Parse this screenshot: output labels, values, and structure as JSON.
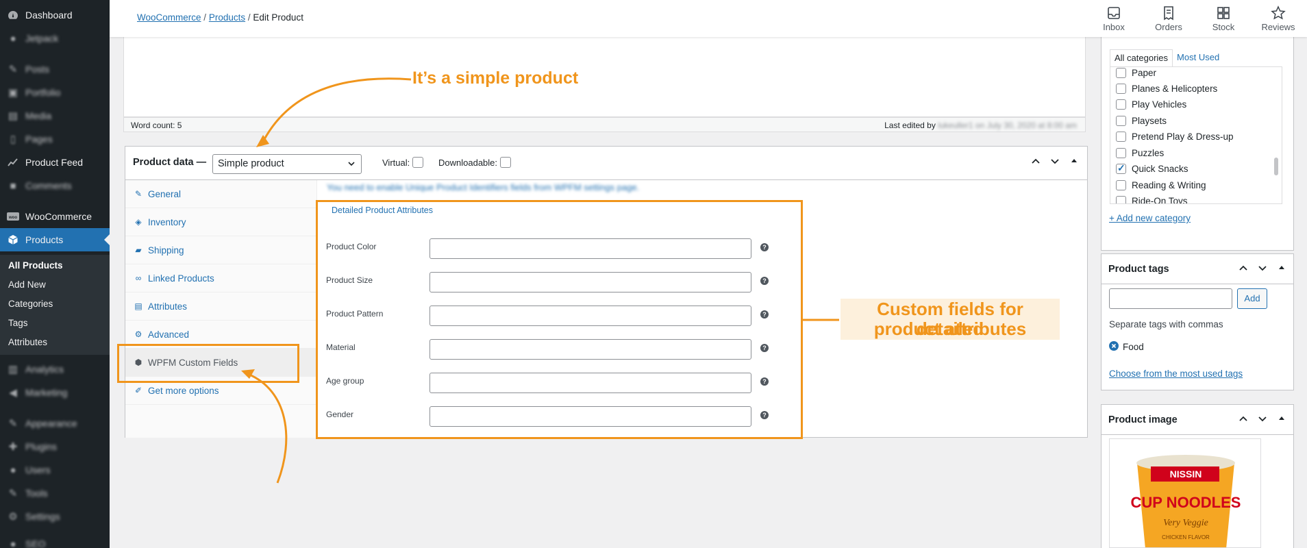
{
  "sidebar": {
    "items": [
      {
        "label": "Dashboard",
        "icon": "dashboard-icon"
      },
      {
        "label": "Jetpack",
        "icon": "jetpack-icon"
      },
      {
        "label": "Posts",
        "icon": "pin-icon"
      },
      {
        "label": "Portfolio",
        "icon": "portfolio-icon"
      },
      {
        "label": "Media",
        "icon": "media-icon"
      },
      {
        "label": "Pages",
        "icon": "pages-icon"
      },
      {
        "label": "Product Feed",
        "icon": "chart-line-icon"
      },
      {
        "label": "Comments",
        "icon": "comment-icon"
      },
      {
        "label": "WooCommerce",
        "icon": "woo-icon"
      },
      {
        "label": "Products",
        "icon": "box-icon"
      },
      {
        "label": "Analytics",
        "icon": "analytics-icon"
      },
      {
        "label": "Marketing",
        "icon": "megaphone-icon"
      },
      {
        "label": "Appearance",
        "icon": "brush-icon"
      },
      {
        "label": "Plugins",
        "icon": "plug-icon"
      },
      {
        "label": "Users",
        "icon": "user-icon"
      },
      {
        "label": "Tools",
        "icon": "wrench-icon"
      },
      {
        "label": "Settings",
        "icon": "settings-icon"
      },
      {
        "label": "SEO",
        "icon": "seo-icon"
      }
    ],
    "submenu": [
      "All Products",
      "Add New",
      "Categories",
      "Tags",
      "Attributes"
    ]
  },
  "header": {
    "breadcrumb": [
      "WooCommerce",
      "Products",
      "Edit Product"
    ],
    "separator": "/",
    "actions": [
      "Inbox",
      "Orders",
      "Stock",
      "Reviews"
    ]
  },
  "editor": {
    "word_count": "Word count: 5",
    "last_edited_prefix": "Last edited by",
    "last_edited_rest": "lukeuller1 on July 30, 2020 at 8:00 am"
  },
  "product_data": {
    "title": "Product data —",
    "type_selected": "Simple product",
    "virtual_label": "Virtual:",
    "downloadable_label": "Downloadable:",
    "tabs": [
      "General",
      "Inventory",
      "Shipping",
      "Linked Products",
      "Attributes",
      "Advanced",
      "WPFM Custom Fields",
      "Get more options"
    ],
    "notice": "You need to enable Unique Product Identifiers fields from WPFM settings page.",
    "section_title": "Detailed Product Attributes",
    "fields": [
      "Product Color",
      "Product Size",
      "Product Pattern",
      "Material",
      "Age group",
      "Gender"
    ],
    "help_glyph": "?"
  },
  "categories": {
    "tabs": [
      "All categories",
      "Most Used"
    ],
    "items": [
      {
        "label": "Paper",
        "checked": false
      },
      {
        "label": "Planes & Helicopters",
        "checked": false
      },
      {
        "label": "Play Vehicles",
        "checked": false
      },
      {
        "label": "Playsets",
        "checked": false
      },
      {
        "label": "Pretend Play & Dress-up",
        "checked": false
      },
      {
        "label": "Puzzles",
        "checked": false
      },
      {
        "label": "Quick Snacks",
        "checked": true
      },
      {
        "label": "Reading & Writing",
        "checked": false
      },
      {
        "label": "Ride-On Toys",
        "checked": false
      }
    ],
    "add_new": "+ Add new category"
  },
  "tags": {
    "title": "Product tags",
    "add": "Add",
    "hint": "Separate tags with commas",
    "current": "Food",
    "choose": "Choose from the most used tags"
  },
  "image_panel": {
    "title": "Product image",
    "product_brand": "NISSIN",
    "product_name": "CUP NOODLES",
    "product_variant": "Very Veggie",
    "product_flavor": "CHICKEN FLAVOR"
  },
  "annotations": {
    "simple": "It’s a simple product",
    "custom_line1": "Custom fields for detailed",
    "custom_line2": "product attributes"
  },
  "colors": {
    "accent": "#2271b1",
    "annotation": "#f0951c",
    "sidebar": "#1d2327"
  }
}
